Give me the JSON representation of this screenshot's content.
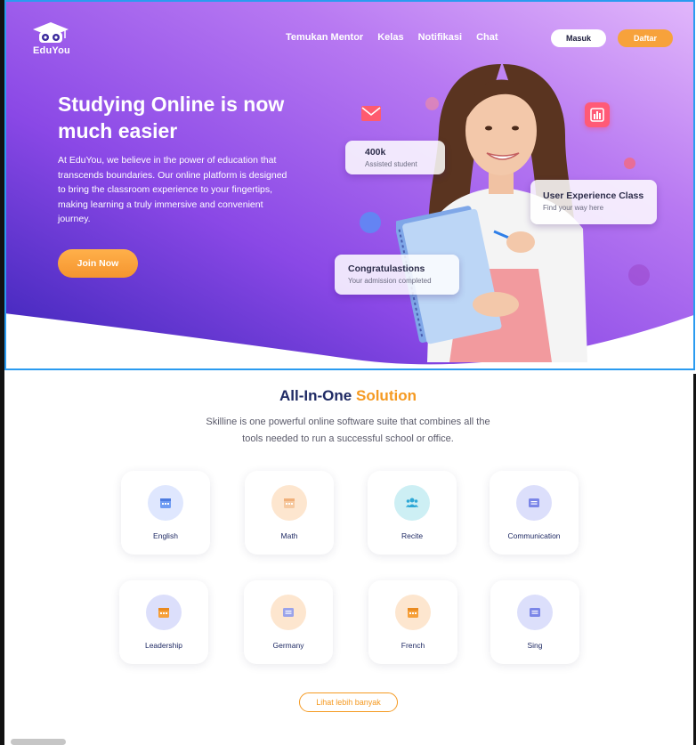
{
  "brand": {
    "name": "EduYou",
    "logo_icon": "owl-graduation-cap-icon"
  },
  "nav": {
    "links": [
      "Temukan Mentor",
      "Kelas",
      "Notifikasi",
      "Chat"
    ],
    "login_label": "Masuk",
    "register_label": "Daftar"
  },
  "hero": {
    "title": "Studying Online is now much easier",
    "description": "At EduYou, we believe in the power of education that transcends boundaries. Our online platform is designed to bring the classroom experience to your fingertips, making learning a truly immersive and convenient journey.",
    "cta_label": "Join Now",
    "cards": {
      "students": {
        "title": "400k",
        "subtitle": "Assisted student"
      },
      "ux": {
        "title": "User Experience Class",
        "subtitle": "Find your way here"
      },
      "congrats": {
        "title": "Congratulastions",
        "subtitle": "Your admission completed"
      }
    }
  },
  "solution": {
    "title_part1": "All-In-One",
    "title_part2": "Solution",
    "description": "Skilline is one powerful online software suite that combines all the tools needed to run a successful school or office.",
    "items": [
      {
        "label": "English",
        "icon": "calendar-icon"
      },
      {
        "label": "Math",
        "icon": "calendar-icon"
      },
      {
        "label": "Recite",
        "icon": "users-icon"
      },
      {
        "label": "Communication",
        "icon": "document-icon"
      },
      {
        "label": "Leadership",
        "icon": "calendar-icon"
      },
      {
        "label": "Germany",
        "icon": "document-icon"
      },
      {
        "label": "French",
        "icon": "calendar-icon"
      },
      {
        "label": "Sing",
        "icon": "document-icon"
      }
    ],
    "more_label": "Lihat lebih banyak"
  },
  "colors": {
    "accent_orange": "#f59a22",
    "hero_purple": "#9b4dea",
    "heading_navy": "#1f2a64",
    "selection_blue": "#2a9bf0"
  }
}
